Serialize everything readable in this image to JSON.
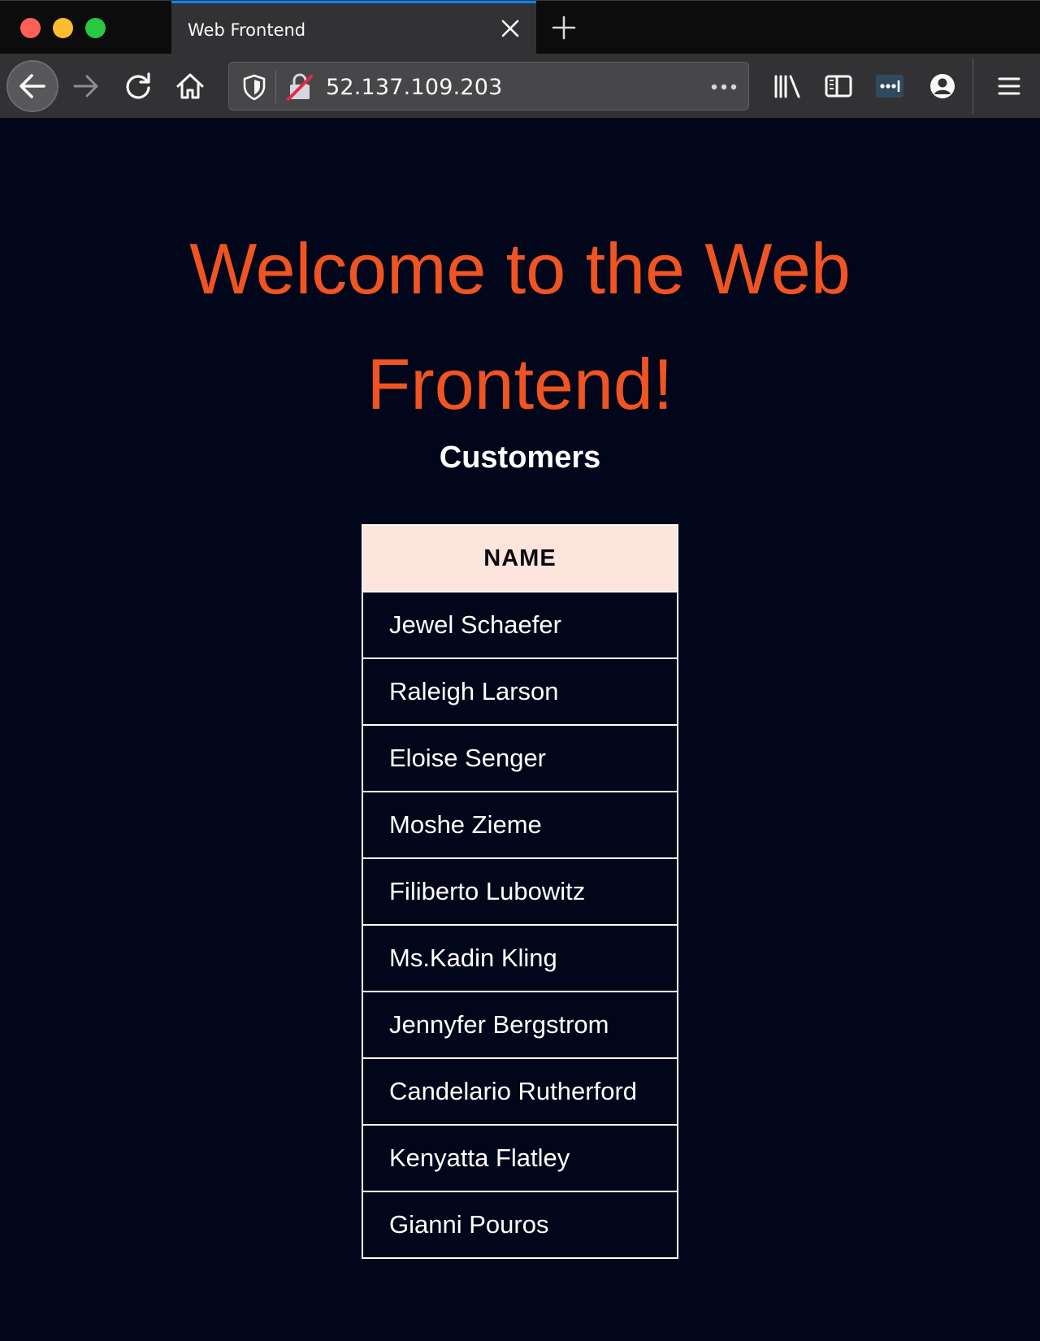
{
  "browser": {
    "tab": {
      "title": "Web Frontend"
    },
    "address_bar": {
      "url": "52.137.109.203"
    },
    "toolbar_icons": [
      "back-icon",
      "forward-icon",
      "reload-icon",
      "home-icon",
      "tracking-shield-icon",
      "insecure-lock-icon",
      "page-actions-icon",
      "library-icon",
      "sidebar-icon",
      "extension-icon",
      "account-icon",
      "menu-icon"
    ]
  },
  "page": {
    "heading": "Welcome to the Web Frontend!",
    "subheading": "Customers",
    "table": {
      "header": "NAME",
      "rows": [
        "Jewel Schaefer",
        "Raleigh Larson",
        "Eloise Senger",
        "Moshe Zieme",
        "Filiberto Lubowitz",
        "Ms.Kadin Kling",
        "Jennyfer Bergstrom",
        "Candelario Rutherford",
        "Kenyatta Flatley",
        "Gianni Pouros"
      ]
    }
  },
  "colors": {
    "heading": "#f05422",
    "background": "#02061a",
    "table_header_bg": "#fde4dc",
    "tab_accent": "#0a84ff"
  }
}
